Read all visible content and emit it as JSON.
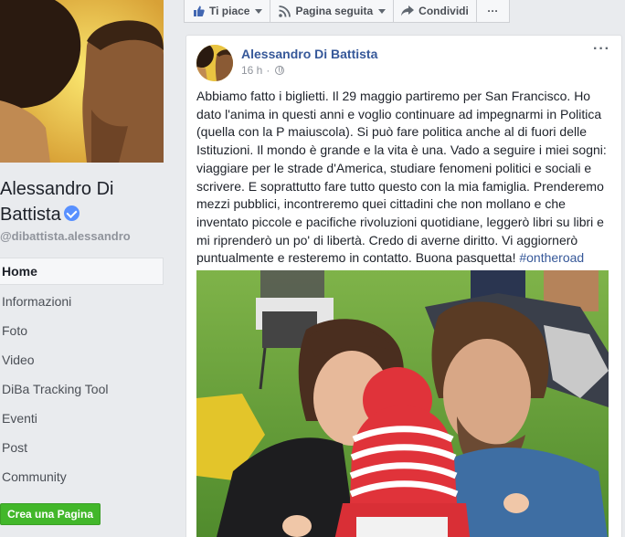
{
  "page": {
    "name": "Alessandro Di Battista",
    "handle": "@dibattista.alessandro",
    "nav": [
      {
        "label": "Home",
        "active": true
      },
      {
        "label": "Informazioni"
      },
      {
        "label": "Foto"
      },
      {
        "label": "Video"
      },
      {
        "label": "DiBa Tracking Tool"
      },
      {
        "label": "Eventi"
      },
      {
        "label": "Post"
      },
      {
        "label": "Community"
      }
    ],
    "create_page_label": "Crea una Pagina"
  },
  "actionbar": {
    "like_label": "Ti piace",
    "follow_label": "Pagina seguita",
    "share_label": "Condividi",
    "more_label": "···"
  },
  "post": {
    "author": "Alessandro Di Battista",
    "time": "16 h",
    "separator": "·",
    "options_label": "···",
    "text": "Abbiamo fatto i biglietti. Il 29 maggio partiremo per San Francisco. Ho dato l'anima in questi anni e voglio continuare ad impegnarmi in Politica (quella con la P maiuscola). Si può fare politica anche al di fuori delle Istituzioni. Il mondo è grande e la vita è una. Vado a seguire i miei sogni: viaggiare per le strade d'America, studiare fenomeni politici e sociali e scrivere. E soprattutto fare tutto questo con la mia famiglia. Prenderemo mezzi pubblici, incontreremo quei cittadini che non mollano e che inventato piccole e pacifiche rivoluzioni quotidiane, leggerò libri su libri e mi riprenderò un po' di libertà. Credo di averne diritto. Vi aggiornerò puntualmente e resteremo in contatto. Buona pasquetta!",
    "hashtag": "#ontheroad"
  },
  "colors": {
    "link": "#365899",
    "create_button": "#42b72a",
    "verified": "#5890ff"
  },
  "icons": [
    "thumbs-up-icon",
    "rss-icon",
    "share-arrow-icon",
    "more-icon",
    "globe-icon",
    "verified-badge-icon"
  ]
}
